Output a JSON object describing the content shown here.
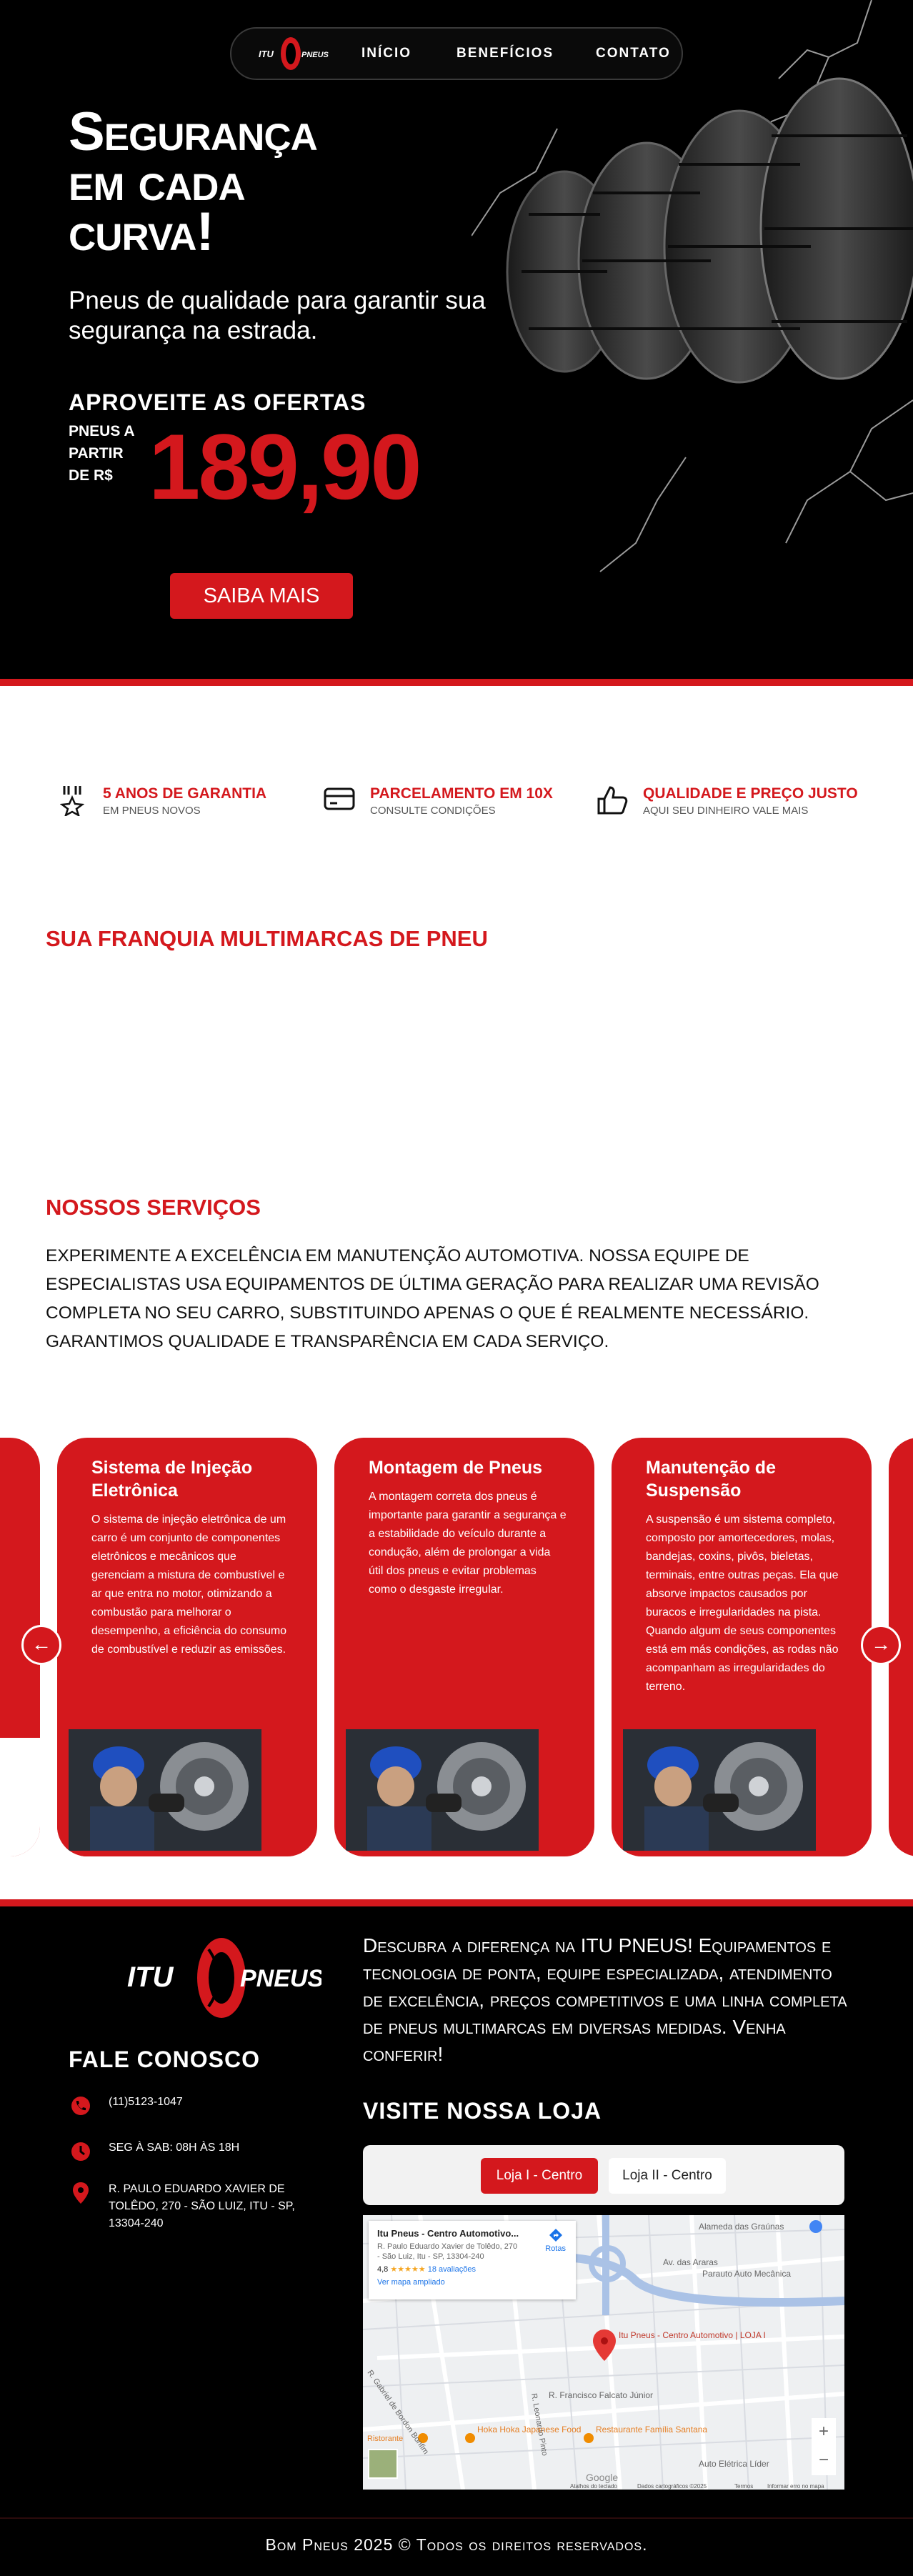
{
  "nav": {
    "logo_left": "ITU",
    "logo_right": "PNEUS",
    "items": [
      "INÍCIO",
      "BENEFÍCIOS",
      "CONTATO"
    ]
  },
  "hero": {
    "title_lines": [
      "Segurança",
      "em cada",
      "curva!"
    ],
    "subtitle": "Pneus de qualidade para garantir sua segurança na estrada.",
    "offer_title": "APROVEITE AS OFERTAS",
    "offer_prefix": "PNEUS A PARTIR DE R$",
    "price": "189,90",
    "cta": "SAIBA MAIS"
  },
  "features": [
    {
      "icon": "medal-icon",
      "title": "5 ANOS DE GARANTIA",
      "subtitle": "EM PNEUS NOVOS"
    },
    {
      "icon": "credit-card-icon",
      "title": "PARCELAMENTO EM 10X",
      "subtitle": "CONSULTE CONDIÇÕES"
    },
    {
      "icon": "thumbs-up-icon",
      "title": "QUALIDADE E PREÇO JUSTO",
      "subtitle": "AQUI SEU DINHEIRO VALE MAIS"
    }
  ],
  "franquia_title": "SUA FRANQUIA MULTIMARCAS DE PNEU",
  "services": {
    "title": "NOSSOS SERVIÇOS",
    "text": "EXPERIMENTE A EXCELÊNCIA EM MANUTENÇÃO AUTOMOTIVA. NOSSA EQUIPE DE ESPECIALISTAS USA EQUIPAMENTOS DE ÚLTIMA GERAÇÃO PARA REALIZAR UMA REVISÃO COMPLETA NO SEU CARRO, SUBSTITUINDO APENAS O QUE É REALMENTE NECESSÁRIO. GARANTIMOS QUALIDADE E TRANSPARÊNCIA EM CADA SERVIÇO.",
    "cards": [
      {
        "title": "Sistema de Injeção Eletrônica",
        "body": "O sistema de injeção eletrônica de um carro é um conjunto de componentes eletrônicos e mecânicos que gerenciam a mistura de combustível e ar que entra no motor, otimizando a combustão para melhorar o desempenho, a eficiência do consumo de combustível e reduzir as emissões."
      },
      {
        "title": "Montagem de Pneus",
        "body": "A montagem correta dos pneus é importante para garantir a segurança e a estabilidade do veículo durante a condução, além de prolongar a vida útil dos pneus e evitar problemas como o desgaste irregular."
      },
      {
        "title": "Manutenção de Suspensão",
        "body": "A suspensão é um sistema completo, composto por amortecedores, molas, bandejas, coxins, pivôs, bieletas, terminais, entre outras peças. Ela que absorve impactos causados por buracos e irregularidades na pista. Quando algum de seus componentes está em más condições, as rodas não acompanham as irregularidades do terreno."
      }
    ],
    "prev_label": "←",
    "next_label": "→"
  },
  "footer": {
    "logo_left": "ITU",
    "logo_right": "PNEUS",
    "contact_title": "FALE CONOSCO",
    "phone": "(11)5123-1047",
    "hours": "SEG À SAB: 08H ÀS 18H",
    "address": "R. PAULO EDUARDO XAVIER DE TOLÊDO, 270 - SÃO LUIZ, ITU - SP, 13304-240",
    "about": "Descubra a diferença na ITU PNEUS! Equipamentos e tecnologia de ponta, equipe especializada, atendimento de excelência, preços competitivos e uma linha completa de pneus multimarcas em diversas medidas. Venha conferir!",
    "visit_title": "VISITE NOSSA LOJA",
    "store_tabs": [
      "Loja I - Centro",
      "Loja II - Centro"
    ],
    "copyright": "Bom Pneus 2025 © Todos os direitos reservados."
  },
  "map": {
    "place_name": "Itu Pneus - Centro Automotivo...",
    "place_address": "R. Paulo Eduardo Xavier de Tolêdo, 270 - São Luiz, Itu - SP, 13304-240",
    "rating": "4,8",
    "stars": "★★★★★",
    "reviews": "18 avaliações",
    "enlarge": "Ver mapa ampliado",
    "directions": "Rotas",
    "pin_label": "Itu Pneus - Centro Automotivo | LOJA I",
    "streets": [
      "Alameda das Graúnas",
      "Av. das Araras",
      "Parauto Auto Mecânica",
      "R. Leonardo Pinto",
      "R. Gabriel de Bordon Bonfim",
      "R. Francisco Falcato Júnior",
      "Hoka Hoka Japanese Food",
      "Restaurante Família Santana",
      "Auto Elétrica Líder",
      "Ristorante"
    ],
    "zoom_in": "+",
    "zoom_out": "−",
    "attribution": [
      "Atalhos do teclado",
      "Dados cartográficos ©2025",
      "Termos",
      "Informar erro no mapa"
    ],
    "google": "Google"
  },
  "colors": {
    "accent": "#d4181d",
    "background_dark": "#000000",
    "text_light": "#ffffff"
  }
}
